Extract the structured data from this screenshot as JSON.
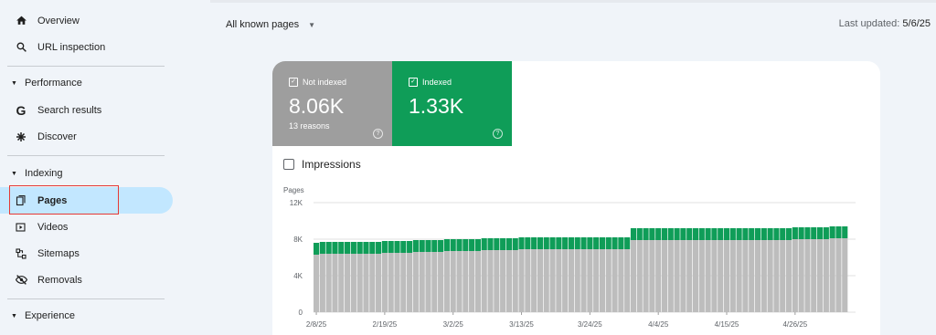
{
  "sidebar": {
    "items": [
      {
        "label": "Overview",
        "icon": "home-icon"
      },
      {
        "label": "URL inspection",
        "icon": "search-icon"
      }
    ],
    "sections": [
      {
        "label": "Performance"
      },
      {
        "label": "Indexing"
      },
      {
        "label": "Experience"
      }
    ],
    "performance_items": [
      {
        "label": "Search results",
        "icon": "google-g-icon"
      },
      {
        "label": "Discover",
        "icon": "asterisk-icon"
      }
    ],
    "indexing_items": [
      {
        "label": "Pages",
        "icon": "pages-icon",
        "active": true
      },
      {
        "label": "Videos",
        "icon": "video-icon"
      },
      {
        "label": "Sitemaps",
        "icon": "sitemap-icon"
      },
      {
        "label": "Removals",
        "icon": "eye-off-icon"
      }
    ]
  },
  "header": {
    "filter_label": "All known pages",
    "updated_label": "Last updated: ",
    "updated_value": "5/6/25"
  },
  "tiles": {
    "not_indexed": {
      "label": "Not indexed",
      "value": "8.06K",
      "sub": "13 reasons",
      "color": "#9e9e9e"
    },
    "indexed": {
      "label": "Indexed",
      "value": "1.33K",
      "color": "#0f9d58"
    }
  },
  "impressions_label": "Impressions",
  "chart_data": {
    "type": "bar",
    "stacked": true,
    "ylabel": "Pages",
    "ylim": [
      0,
      12000
    ],
    "y_ticks": [
      "0",
      "4K",
      "8K",
      "12K"
    ],
    "x_tick_labels": [
      "2/8/25",
      "2/19/25",
      "3/2/25",
      "3/13/25",
      "3/24/25",
      "4/4/25",
      "4/15/25",
      "4/26/25"
    ],
    "colors": {
      "not_indexed": "#bdbdbd",
      "indexed": "#0f9d58"
    },
    "categories": [
      "2/8",
      "2/9",
      "2/10",
      "2/11",
      "2/12",
      "2/13",
      "2/14",
      "2/15",
      "2/16",
      "2/17",
      "2/18",
      "2/19",
      "2/20",
      "2/21",
      "2/22",
      "2/23",
      "2/24",
      "2/25",
      "2/26",
      "2/27",
      "2/28",
      "3/1",
      "3/2",
      "3/3",
      "3/4",
      "3/5",
      "3/6",
      "3/7",
      "3/8",
      "3/9",
      "3/10",
      "3/11",
      "3/12",
      "3/13",
      "3/14",
      "3/15",
      "3/16",
      "3/17",
      "3/18",
      "3/19",
      "3/20",
      "3/21",
      "3/22",
      "3/23",
      "3/24",
      "3/25",
      "3/26",
      "3/27",
      "3/28",
      "3/29",
      "3/30",
      "3/31",
      "4/1",
      "4/2",
      "4/3",
      "4/4",
      "4/5",
      "4/6",
      "4/7",
      "4/8",
      "4/9",
      "4/10",
      "4/11",
      "4/12",
      "4/13",
      "4/14",
      "4/15",
      "4/16",
      "4/17",
      "4/18",
      "4/19",
      "4/20",
      "4/21",
      "4/22",
      "4/23",
      "4/24",
      "4/25",
      "4/26",
      "4/27",
      "4/28",
      "4/29",
      "4/30",
      "5/1",
      "5/2",
      "5/3",
      "5/4"
    ],
    "series": [
      {
        "name": "Not indexed",
        "values": [
          6300,
          6400,
          6400,
          6400,
          6400,
          6400,
          6400,
          6400,
          6400,
          6400,
          6400,
          6500,
          6500,
          6500,
          6500,
          6500,
          6600,
          6600,
          6600,
          6600,
          6600,
          6700,
          6700,
          6700,
          6700,
          6700,
          6700,
          6800,
          6800,
          6800,
          6800,
          6800,
          6800,
          6900,
          6900,
          6900,
          6900,
          6900,
          6900,
          6900,
          6900,
          6900,
          6900,
          6900,
          6900,
          6900,
          6900,
          6900,
          6900,
          6900,
          6900,
          7900,
          7900,
          7900,
          7900,
          7900,
          7900,
          7900,
          7900,
          7900,
          7900,
          7900,
          7900,
          7900,
          7900,
          7900,
          7900,
          7900,
          7900,
          7900,
          7900,
          7900,
          7900,
          7900,
          7900,
          7900,
          7900,
          8000,
          8000,
          8000,
          8000,
          8000,
          8000,
          8100,
          8100,
          8100
        ]
      },
      {
        "name": "Indexed",
        "values": [
          1300,
          1300,
          1300,
          1300,
          1300,
          1300,
          1300,
          1300,
          1300,
          1300,
          1300,
          1300,
          1300,
          1300,
          1300,
          1300,
          1300,
          1300,
          1300,
          1300,
          1300,
          1300,
          1300,
          1300,
          1300,
          1300,
          1300,
          1300,
          1300,
          1300,
          1300,
          1300,
          1300,
          1300,
          1300,
          1300,
          1300,
          1300,
          1300,
          1300,
          1300,
          1300,
          1300,
          1300,
          1300,
          1300,
          1300,
          1300,
          1300,
          1300,
          1300,
          1300,
          1300,
          1300,
          1300,
          1300,
          1300,
          1300,
          1300,
          1300,
          1300,
          1300,
          1300,
          1300,
          1300,
          1300,
          1300,
          1300,
          1300,
          1300,
          1300,
          1300,
          1300,
          1300,
          1300,
          1300,
          1300,
          1300,
          1300,
          1300,
          1300,
          1300,
          1300,
          1300,
          1300,
          1300
        ]
      }
    ]
  }
}
